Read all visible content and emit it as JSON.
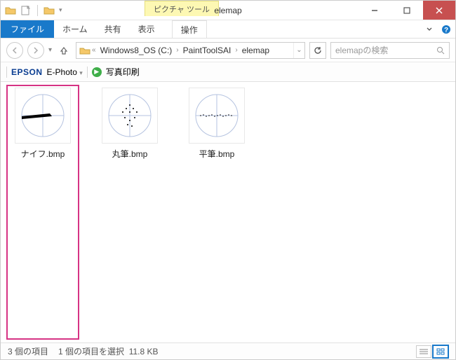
{
  "window_title": "elemap",
  "context_tab": "ピクチャ ツール",
  "ribbon": {
    "file": "ファイル",
    "home": "ホーム",
    "share": "共有",
    "view": "表示",
    "manage": "操作"
  },
  "breadcrumbs": {
    "b0": "Windows8_OS (C:)",
    "b1": "PaintToolSAI",
    "b2": "elemap"
  },
  "search_placeholder": "elemapの検索",
  "epson": {
    "logo": "EPSON",
    "product": "E-Photo",
    "print": "写真印刷"
  },
  "files": {
    "f0": "ナイフ.bmp",
    "f1": "丸筆.bmp",
    "f2": "平筆.bmp"
  },
  "status": {
    "count": "3 個の項目",
    "sel": "1 個の項目を選択",
    "size": "11.8 KB"
  }
}
